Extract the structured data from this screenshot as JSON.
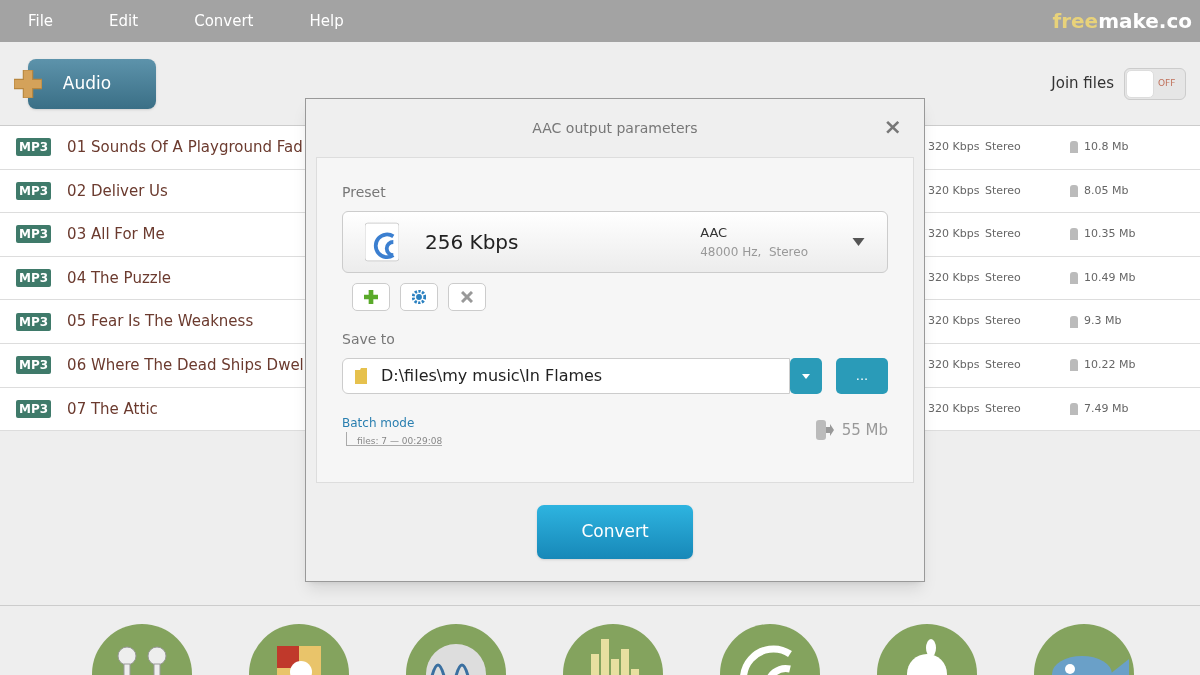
{
  "menu": [
    "File",
    "Edit",
    "Convert",
    "Help"
  ],
  "logo": {
    "part_1": "free",
    "part_2": "make.co"
  },
  "toolbar": {
    "add_button": "Audio",
    "join_files": {
      "label": "Join files",
      "on": false,
      "state_text": "OFF"
    }
  },
  "files": [
    {
      "badge": "MP3",
      "title": "01 Sounds Of A Playground Fad",
      "bitrate": "320 Kbps",
      "channels": "Stereo",
      "size": "10.8 Mb"
    },
    {
      "badge": "MP3",
      "title": "02 Deliver Us",
      "bitrate": "320 Kbps",
      "channels": "Stereo",
      "size": "8.05 Mb"
    },
    {
      "badge": "MP3",
      "title": "03 All For Me",
      "bitrate": "320 Kbps",
      "channels": "Stereo",
      "size": "10.35 Mb"
    },
    {
      "badge": "MP3",
      "title": "04 The Puzzle",
      "bitrate": "320 Kbps",
      "channels": "Stereo",
      "size": "10.49 Mb"
    },
    {
      "badge": "MP3",
      "title": "05 Fear Is The Weakness",
      "bitrate": "320 Kbps",
      "channels": "Stereo",
      "size": "9.3 Mb"
    },
    {
      "badge": "MP3",
      "title": "06 Where The Dead Ships Dwel",
      "bitrate": "320 Kbps",
      "channels": "Stereo",
      "size": "10.22 Mb"
    },
    {
      "badge": "MP3",
      "title": "07 The Attic",
      "bitrate": "320 Kbps",
      "channels": "Stereo",
      "size": "7.49 Mb"
    }
  ],
  "dialog": {
    "title": "AAC output parameters",
    "close": "×",
    "preset_label": "Preset",
    "preset": {
      "name": "256 Kbps",
      "format": "AAC",
      "details": "48000 Hz,  Stereo"
    },
    "save_to_label": "Save to",
    "save_path": "D:\\files\\my music\\In Flames",
    "browse_button": "...",
    "batch_mode": "Batch mode",
    "batch_info": "files: 7 — 00:29:08",
    "output_size": "55 Mb",
    "convert_button": "Convert"
  },
  "formats": [
    {
      "kind": "headphones"
    },
    {
      "kind": "windows"
    },
    {
      "kind": "wave"
    },
    {
      "kind": "equalizer"
    },
    {
      "kind": "aac"
    },
    {
      "kind": "apple"
    },
    {
      "kind": "fish"
    }
  ]
}
